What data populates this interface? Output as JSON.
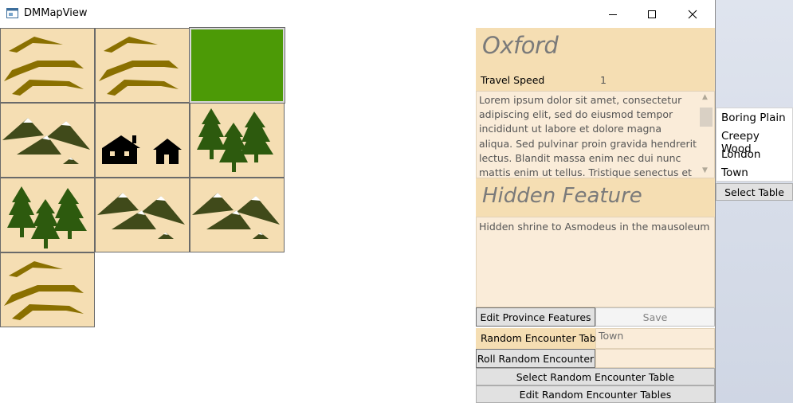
{
  "window": {
    "title": "DMMapView"
  },
  "titlebar_buttons": {
    "minimize_icon": "minimize-icon",
    "maximize_icon": "maximize-icon",
    "close_icon": "close-icon"
  },
  "colors": {
    "tile_background": "#f5deb3",
    "selected_tile": "#4c9a06",
    "hills": "#8a7000",
    "mountains": "#404a1a",
    "forest": "#2d5a0e",
    "house": "#000000",
    "panel_header": "#f5deb3",
    "panel_field": "#faecd9"
  },
  "map": {
    "tiles": [
      {
        "terrain": "hills",
        "icon": "hills-icon"
      },
      {
        "terrain": "hills",
        "icon": "hills-icon"
      },
      {
        "terrain": "selected",
        "icon": "selected-tile"
      },
      {
        "terrain": "mountains",
        "icon": "mountains-icon"
      },
      {
        "terrain": "town",
        "icon": "houses-icon"
      },
      {
        "terrain": "forest",
        "icon": "forest-icon"
      },
      {
        "terrain": "forest",
        "icon": "forest-icon"
      },
      {
        "terrain": "mountains",
        "icon": "mountains-icon"
      },
      {
        "terrain": "mountains",
        "icon": "mountains-icon"
      },
      {
        "terrain": "hills",
        "icon": "hills-icon"
      }
    ]
  },
  "province": {
    "name": "Oxford",
    "travel_speed_label": "Travel Speed",
    "travel_speed_value": "1",
    "description": "Lorem ipsum dolor sit amet, consectetur adipiscing elit, sed do eiusmod tempor incididunt ut labore et dolore magna aliqua. Sed pulvinar proin gravida hendrerit lectus. Blandit massa enim nec dui nunc mattis enim ut tellus. Tristique senectus et netus et"
  },
  "hidden_feature": {
    "title": "Hidden Feature",
    "text": "Hidden shrine to Asmodeus in the mausoleum"
  },
  "buttons": {
    "edit_province_features": "Edit Province Features",
    "save": "Save",
    "roll_random_encounter": "Roll Random Encounter",
    "select_random_encounter_table": "Select Random Encounter Table",
    "edit_random_encounter_tables": "Edit Random Encounter Tables",
    "select_table": "Select Table"
  },
  "random_encounter": {
    "label": "Random Encounter Tab",
    "value": "Town"
  },
  "table_list": {
    "items": [
      "Boring Plain",
      "Creepy Wood",
      "London",
      "Town"
    ]
  }
}
